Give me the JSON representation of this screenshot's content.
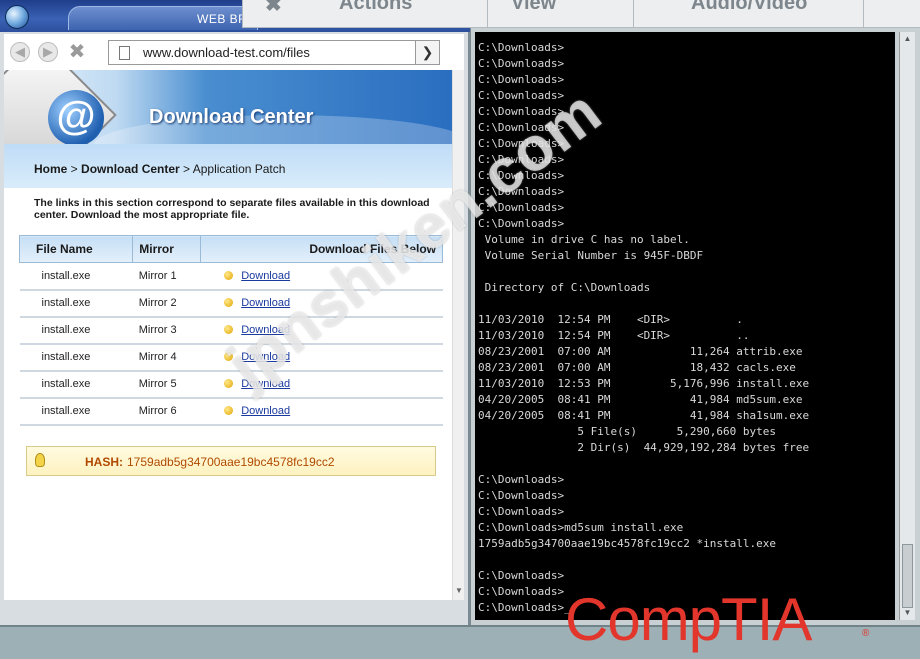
{
  "browser": {
    "title": "WEB BR",
    "url": "www.download-test.com/files",
    "banner_title": "Download Center",
    "breadcrumb": {
      "home": "Home",
      "sep1": " > ",
      "center": "Download Center",
      "sep2": " > ",
      "current": "Application Patch"
    },
    "intro": "The links in this section correspond to separate files available in this download center. Download the most appropriate file.",
    "table": {
      "headers": [
        "File Name",
        "Mirror",
        "Download Files Below"
      ],
      "rows": [
        {
          "file": "install.exe",
          "mirror": "Mirror 1",
          "link": "Download"
        },
        {
          "file": "install.exe",
          "mirror": "Mirror 2",
          "link": "Download"
        },
        {
          "file": "install.exe",
          "mirror": "Mirror 3",
          "link": "Download"
        },
        {
          "file": "install.exe",
          "mirror": "Mirror 4",
          "link": "Download"
        },
        {
          "file": "install.exe",
          "mirror": "Mirror 5",
          "link": "Download"
        },
        {
          "file": "install.exe",
          "mirror": "Mirror 6",
          "link": "Download"
        }
      ]
    },
    "hash_label": "HASH:",
    "hash_value": "1759adb5g34700aae19bc4578fc19cc2"
  },
  "vm_toolbar": {
    "actions": "Actions",
    "view": "View",
    "audio_video": "Audio/Video"
  },
  "terminal": {
    "lines": [
      "C:\\Downloads>",
      "C:\\Downloads>",
      "C:\\Downloads>",
      "C:\\Downloads>",
      "C:\\Downloads>",
      "C:\\Downloads>",
      "C:\\Downloads>",
      "C:\\Downloads>",
      "C:\\Downloads>",
      "C:\\Downloads>",
      "C:\\Downloads>",
      "C:\\Downloads>",
      " Volume in drive C has no label.",
      " Volume Serial Number is 945F-DBDF",
      "",
      " Directory of C:\\Downloads",
      "",
      "11/03/2010  12:54 PM    <DIR>          .",
      "11/03/2010  12:54 PM    <DIR>          ..",
      "08/23/2001  07:00 AM            11,264 attrib.exe",
      "08/23/2001  07:00 AM            18,432 cacls.exe",
      "11/03/2010  12:53 PM         5,176,996 install.exe",
      "04/20/2005  08:41 PM            41,984 md5sum.exe",
      "04/20/2005  08:41 PM            41,984 sha1sum.exe",
      "               5 File(s)      5,290,660 bytes",
      "               2 Dir(s)  44,929,192,284 bytes free",
      "",
      "C:\\Downloads>",
      "C:\\Downloads>",
      "C:\\Downloads>",
      "C:\\Downloads>md5sum install.exe",
      "1759adb5g34700aae19bc4578fc19cc2 *install.exe",
      "",
      "C:\\Downloads>",
      "C:\\Downloads>",
      "C:\\Downloads>_"
    ]
  },
  "branding": {
    "logo": "CompTIA",
    "trademark": "®",
    "watermark": "jpnshiken.com"
  },
  "colors": {
    "title_bar": "#2c4f9c",
    "terminal_bg": "#000000",
    "terminal_fg": "#d8d8d8",
    "hash_text": "#b14a00",
    "logo_red": "#e2352b",
    "link": "#1a3a9e"
  }
}
